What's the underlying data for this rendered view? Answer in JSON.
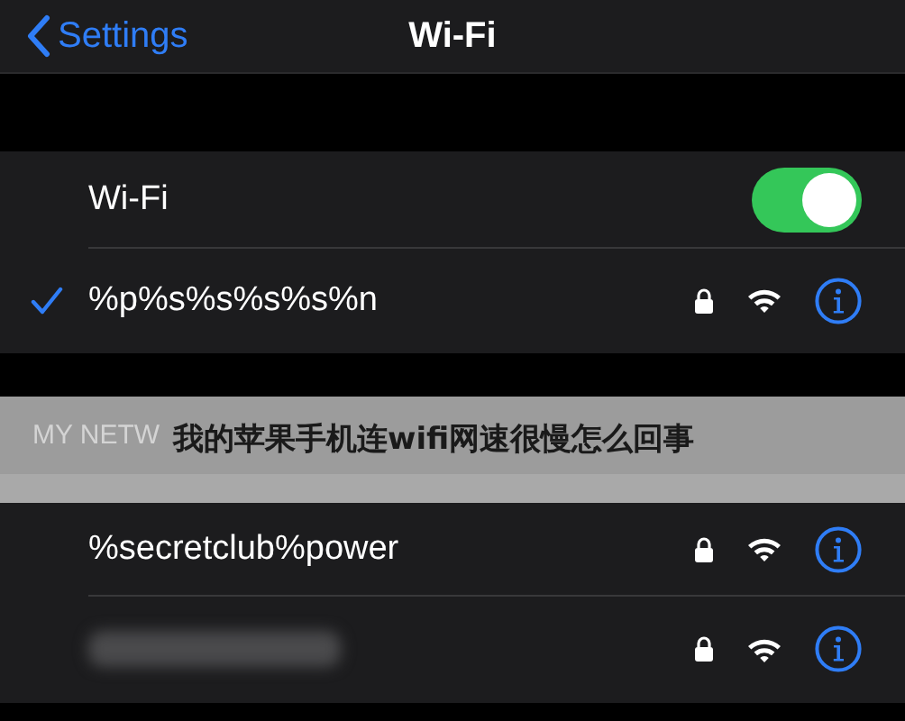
{
  "nav": {
    "back": "Settings",
    "title": "Wi-Fi"
  },
  "wifi_toggle": {
    "label": "Wi-Fi",
    "on": true
  },
  "current_network": {
    "name": "%p%s%s%s%s%n",
    "connected": true,
    "secured": true
  },
  "section_header": "MY NETW",
  "caption": "我的苹果手机连wifi网速很慢怎么回事",
  "networks": [
    {
      "kind": "named",
      "name": "%secretclub%power",
      "secured": true
    },
    {
      "kind": "blurred",
      "secured": true
    }
  ]
}
